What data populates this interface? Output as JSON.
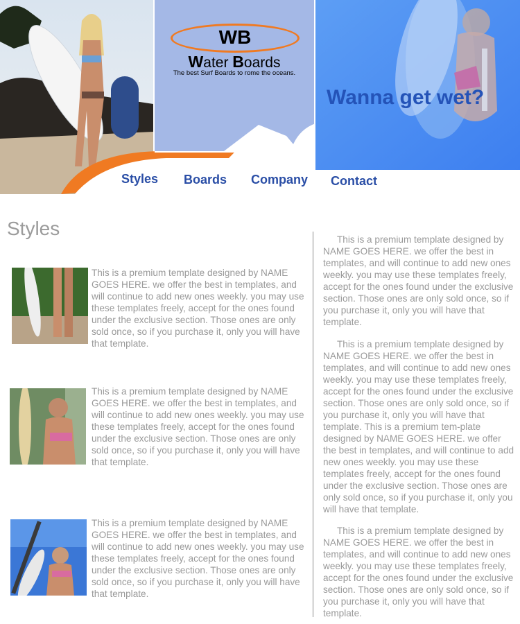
{
  "logo": {
    "initials": "WB",
    "name_first_initial": "W",
    "name_first_rest": "ater ",
    "name_second_initial": "B",
    "name_second_rest": "oards",
    "tagline": "The best Surf Boards to rome the oceans."
  },
  "header": {
    "headline": "Wanna get wet?"
  },
  "nav": {
    "items": [
      {
        "label": "Styles"
      },
      {
        "label": "Boards"
      },
      {
        "label": "Company"
      },
      {
        "label": "Contact"
      }
    ]
  },
  "page": {
    "title": "Styles"
  },
  "left_column": {
    "items": [
      {
        "text": "This is a premium template designed by NAME GOES HERE.  we offer the best in templates, and will continue to add new ones weekly.  you may use these templates freely, accept for the ones found under the exclusive section.  Those ones are only sold once, so if you purchase it, only you will have that template."
      },
      {
        "text": "This is a premium template designed by NAME GOES HERE.  we offer the best in templates, and will continue to add new ones weekly.  you may use these templates freely, accept for the ones found under the exclusive section.  Those ones are only sold once, so if you purchase it, only you will have that template."
      },
      {
        "text": "This is a premium template designed by NAME GOES HERE.  we offer the best in templates, and will continue to add new ones weekly.  you may use these templates freely, accept for the ones found under the exclusive section.  Those ones are only sold once, so if you purchase it, only you will have that template."
      }
    ]
  },
  "right_column": {
    "paragraphs": [
      "This is a premium template designed by NAME GOES HERE.  we offer the best in templates, and will continue to add new ones weekly.  you may use these templates freely, accept for the ones found under the exclusive section.  Those ones are only sold once, so if you purchase it, only you will have that template.",
      "This is a premium template designed by NAME GOES HERE.  we offer the best in templates, and will continue to add new ones weekly.  you may use these templates freely, accept for the ones found under the exclusive section.  Those ones are only sold once, so if you purchase it, only you will have that template.  This is a premium tem-plate designed by NAME GOES HERE.  we offer the best in templates, and will continue to add new ones weekly.  you may use these templates freely, accept for the ones found under the exclusive section.  Those ones are only sold once, so if you purchase it, only you will have that template.",
      "This is a premium template designed by NAME GOES HERE.  we offer the best in templates, and will continue to add new ones weekly.  you may use these templates freely, accept for the ones found under the exclusive section.  Those ones are only sold once, so if you purchase it, only you will have that template."
    ]
  },
  "colors": {
    "logo_panel": "#a4b8e6",
    "accent_orange": "#f07a22",
    "nav_blue": "#2a4ea6",
    "headline_blue": "#2453b8",
    "body_text": "#999999",
    "sky_blue": "#4a8ff0"
  }
}
